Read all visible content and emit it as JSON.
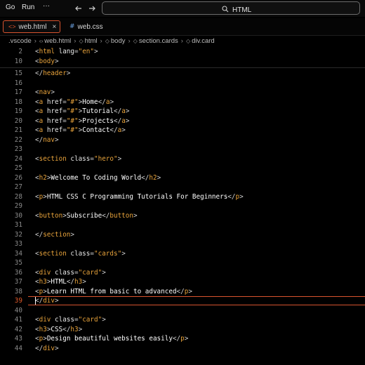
{
  "menu": {
    "go": "Go",
    "run": "Run",
    "more": "···"
  },
  "search": {
    "query": "HTML"
  },
  "tabs": [
    {
      "label": "web.html",
      "icon": "<>",
      "close": "×"
    },
    {
      "label": "web.css",
      "icon": "#"
    }
  ],
  "breadcrumb": [
    ".vscode",
    "web.html",
    "html",
    "body",
    "section.cards",
    "div.card"
  ],
  "editor": {
    "sticky_lines": [
      {
        "n": "2",
        "tokens": [
          [
            "tag",
            "<"
          ],
          [
            "tn",
            "html"
          ],
          [
            "at",
            " lang"
          ],
          [
            "tag",
            "="
          ],
          [
            "st",
            "\"en\""
          ],
          [
            "tag",
            ">"
          ]
        ]
      },
      {
        "n": "10",
        "tokens": [
          [
            "tag",
            "<"
          ],
          [
            "tn",
            "body"
          ],
          [
            "tag",
            ">"
          ]
        ]
      }
    ],
    "lines": [
      {
        "n": "15",
        "tokens": [
          [
            "tag",
            "</"
          ],
          [
            "tn",
            "header"
          ],
          [
            "tag",
            ">"
          ]
        ]
      },
      {
        "n": "16",
        "tokens": []
      },
      {
        "n": "17",
        "tokens": [
          [
            "tag",
            "<"
          ],
          [
            "tn",
            "nav"
          ],
          [
            "tag",
            ">"
          ]
        ]
      },
      {
        "n": "18",
        "tokens": [
          [
            "tag",
            "<"
          ],
          [
            "tn",
            "a"
          ],
          [
            "at",
            " href"
          ],
          [
            "tag",
            "="
          ],
          [
            "st",
            "\"#\""
          ],
          [
            "tag",
            ">"
          ],
          [
            "tx",
            "Home"
          ],
          [
            "tag",
            "</"
          ],
          [
            "tn",
            "a"
          ],
          [
            "tag",
            ">"
          ]
        ]
      },
      {
        "n": "19",
        "tokens": [
          [
            "tag",
            "<"
          ],
          [
            "tn",
            "a"
          ],
          [
            "at",
            " href"
          ],
          [
            "tag",
            "="
          ],
          [
            "st",
            "\"#\""
          ],
          [
            "tag",
            ">"
          ],
          [
            "tx",
            "Tutorial"
          ],
          [
            "tag",
            "</"
          ],
          [
            "tn",
            "a"
          ],
          [
            "tag",
            ">"
          ]
        ]
      },
      {
        "n": "20",
        "tokens": [
          [
            "tag",
            "<"
          ],
          [
            "tn",
            "a"
          ],
          [
            "at",
            " href"
          ],
          [
            "tag",
            "="
          ],
          [
            "st",
            "\"#\""
          ],
          [
            "tag",
            ">"
          ],
          [
            "tx",
            "Projects"
          ],
          [
            "tag",
            "</"
          ],
          [
            "tn",
            "a"
          ],
          [
            "tag",
            ">"
          ]
        ]
      },
      {
        "n": "21",
        "tokens": [
          [
            "tag",
            "<"
          ],
          [
            "tn",
            "a"
          ],
          [
            "at",
            " href"
          ],
          [
            "tag",
            "="
          ],
          [
            "st",
            "\"#\""
          ],
          [
            "tag",
            ">"
          ],
          [
            "tx",
            "Contact"
          ],
          [
            "tag",
            "</"
          ],
          [
            "tn",
            "a"
          ],
          [
            "tag",
            ">"
          ]
        ]
      },
      {
        "n": "22",
        "tokens": [
          [
            "tag",
            "</"
          ],
          [
            "tn",
            "nav"
          ],
          [
            "tag",
            ">"
          ]
        ]
      },
      {
        "n": "23",
        "tokens": []
      },
      {
        "n": "24",
        "tokens": [
          [
            "tag",
            "<"
          ],
          [
            "tn",
            "section"
          ],
          [
            "at",
            " class"
          ],
          [
            "tag",
            "="
          ],
          [
            "st",
            "\"hero\""
          ],
          [
            "tag",
            ">"
          ]
        ]
      },
      {
        "n": "25",
        "tokens": []
      },
      {
        "n": "26",
        "tokens": [
          [
            "tag",
            "<"
          ],
          [
            "tn",
            "h2"
          ],
          [
            "tag",
            ">"
          ],
          [
            "tx",
            "Welcome To Coding World"
          ],
          [
            "tag",
            "</"
          ],
          [
            "tn",
            "h2"
          ],
          [
            "tag",
            ">"
          ]
        ]
      },
      {
        "n": "27",
        "tokens": []
      },
      {
        "n": "28",
        "tokens": [
          [
            "tag",
            "<"
          ],
          [
            "tn",
            "p"
          ],
          [
            "tag",
            ">"
          ],
          [
            "tx",
            "HTML CSS C Programming Tutorials For Beginners"
          ],
          [
            "tag",
            "</"
          ],
          [
            "tn",
            "p"
          ],
          [
            "tag",
            ">"
          ]
        ]
      },
      {
        "n": "29",
        "tokens": []
      },
      {
        "n": "30",
        "tokens": [
          [
            "tag",
            "<"
          ],
          [
            "tn",
            "button"
          ],
          [
            "tag",
            ">"
          ],
          [
            "tx",
            "Subscribe"
          ],
          [
            "tag",
            "</"
          ],
          [
            "tn",
            "button"
          ],
          [
            "tag",
            ">"
          ]
        ]
      },
      {
        "n": "31",
        "tokens": []
      },
      {
        "n": "32",
        "tokens": [
          [
            "tag",
            "</"
          ],
          [
            "tn",
            "section"
          ],
          [
            "tag",
            ">"
          ]
        ]
      },
      {
        "n": "33",
        "tokens": []
      },
      {
        "n": "34",
        "tokens": [
          [
            "tag",
            "<"
          ],
          [
            "tn",
            "section"
          ],
          [
            "at",
            " class"
          ],
          [
            "tag",
            "="
          ],
          [
            "st",
            "\"cards\""
          ],
          [
            "tag",
            ">"
          ]
        ]
      },
      {
        "n": "35",
        "tokens": []
      },
      {
        "n": "36",
        "tokens": [
          [
            "tag",
            "<"
          ],
          [
            "tn",
            "div"
          ],
          [
            "at",
            " class"
          ],
          [
            "tag",
            "="
          ],
          [
            "st",
            "\"card\""
          ],
          [
            "tag",
            ">"
          ]
        ]
      },
      {
        "n": "37",
        "tokens": [
          [
            "tag",
            "<"
          ],
          [
            "tn",
            "h3"
          ],
          [
            "tag",
            ">"
          ],
          [
            "tx",
            "HTML"
          ],
          [
            "tag",
            "</"
          ],
          [
            "tn",
            "h3"
          ],
          [
            "tag",
            ">"
          ]
        ]
      },
      {
        "n": "38",
        "tokens": [
          [
            "tag",
            "<"
          ],
          [
            "tn",
            "p"
          ],
          [
            "tag",
            ">"
          ],
          [
            "tx",
            "Learn HTML from basic to advanced"
          ],
          [
            "tag",
            "</"
          ],
          [
            "tn",
            "p"
          ],
          [
            "tag",
            ">"
          ]
        ]
      },
      {
        "n": "39",
        "current": true,
        "tokens": [
          [
            "tag",
            "</"
          ],
          [
            "tn",
            "div"
          ],
          [
            "tag",
            ">"
          ]
        ]
      },
      {
        "n": "40",
        "tokens": []
      },
      {
        "n": "41",
        "tokens": [
          [
            "tag",
            "<"
          ],
          [
            "tn",
            "div"
          ],
          [
            "at",
            " class"
          ],
          [
            "tag",
            "="
          ],
          [
            "st",
            "\"card\""
          ],
          [
            "tag",
            ">"
          ]
        ]
      },
      {
        "n": "42",
        "tokens": [
          [
            "tag",
            "<"
          ],
          [
            "tn",
            "h3"
          ],
          [
            "tag",
            ">"
          ],
          [
            "tx",
            "CSS"
          ],
          [
            "tag",
            "</"
          ],
          [
            "tn",
            "h3"
          ],
          [
            "tag",
            ">"
          ]
        ]
      },
      {
        "n": "43",
        "tokens": [
          [
            "tag",
            "<"
          ],
          [
            "tn",
            "p"
          ],
          [
            "tag",
            ">"
          ],
          [
            "tx",
            "Design beautiful websites easily"
          ],
          [
            "tag",
            "</"
          ],
          [
            "tn",
            "p"
          ],
          [
            "tag",
            ">"
          ]
        ]
      },
      {
        "n": "44",
        "tokens": [
          [
            "tag",
            "</"
          ],
          [
            "tn",
            "div"
          ],
          [
            "tag",
            ">"
          ]
        ]
      }
    ]
  },
  "colors": {
    "accent": "#d8532e",
    "tag_name": "#e8a33b",
    "string": "#e8a33b",
    "line_number": "#8a8a8a",
    "background": "#000000"
  },
  "icons": {
    "search": "search-icon",
    "back": "arrow-left-icon",
    "forward": "arrow-right-icon",
    "html_file": "html-file-icon",
    "css_file": "css-file-icon"
  }
}
